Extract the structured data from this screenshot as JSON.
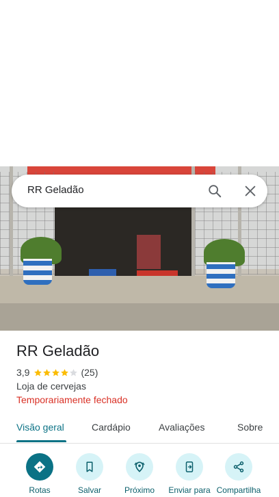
{
  "search": {
    "query": "RR Geladão"
  },
  "place": {
    "name": "RR Geladão",
    "rating": "3,9",
    "rating_value": 3.9,
    "review_count": "(25)",
    "category": "Loja de cervejas",
    "status": "Temporariamente fechado"
  },
  "tabs": [
    {
      "label": "Visão geral",
      "active": true
    },
    {
      "label": "Cardápio"
    },
    {
      "label": "Avaliações"
    },
    {
      "label": "Sobre"
    }
  ],
  "actions": [
    {
      "label": "Rotas",
      "icon": "directions-icon"
    },
    {
      "label": "Salvar",
      "icon": "bookmark-icon"
    },
    {
      "label": "Próximo",
      "icon": "nearby-icon"
    },
    {
      "label": "Enviar para",
      "icon": "send-to-phone-icon"
    },
    {
      "label": "Compartilha",
      "icon": "share-icon"
    }
  ],
  "colors": {
    "accent": "#0b7285",
    "action_bg": "#d6f3f7",
    "closed_status": "#d93025",
    "star": "#fbbc04"
  }
}
